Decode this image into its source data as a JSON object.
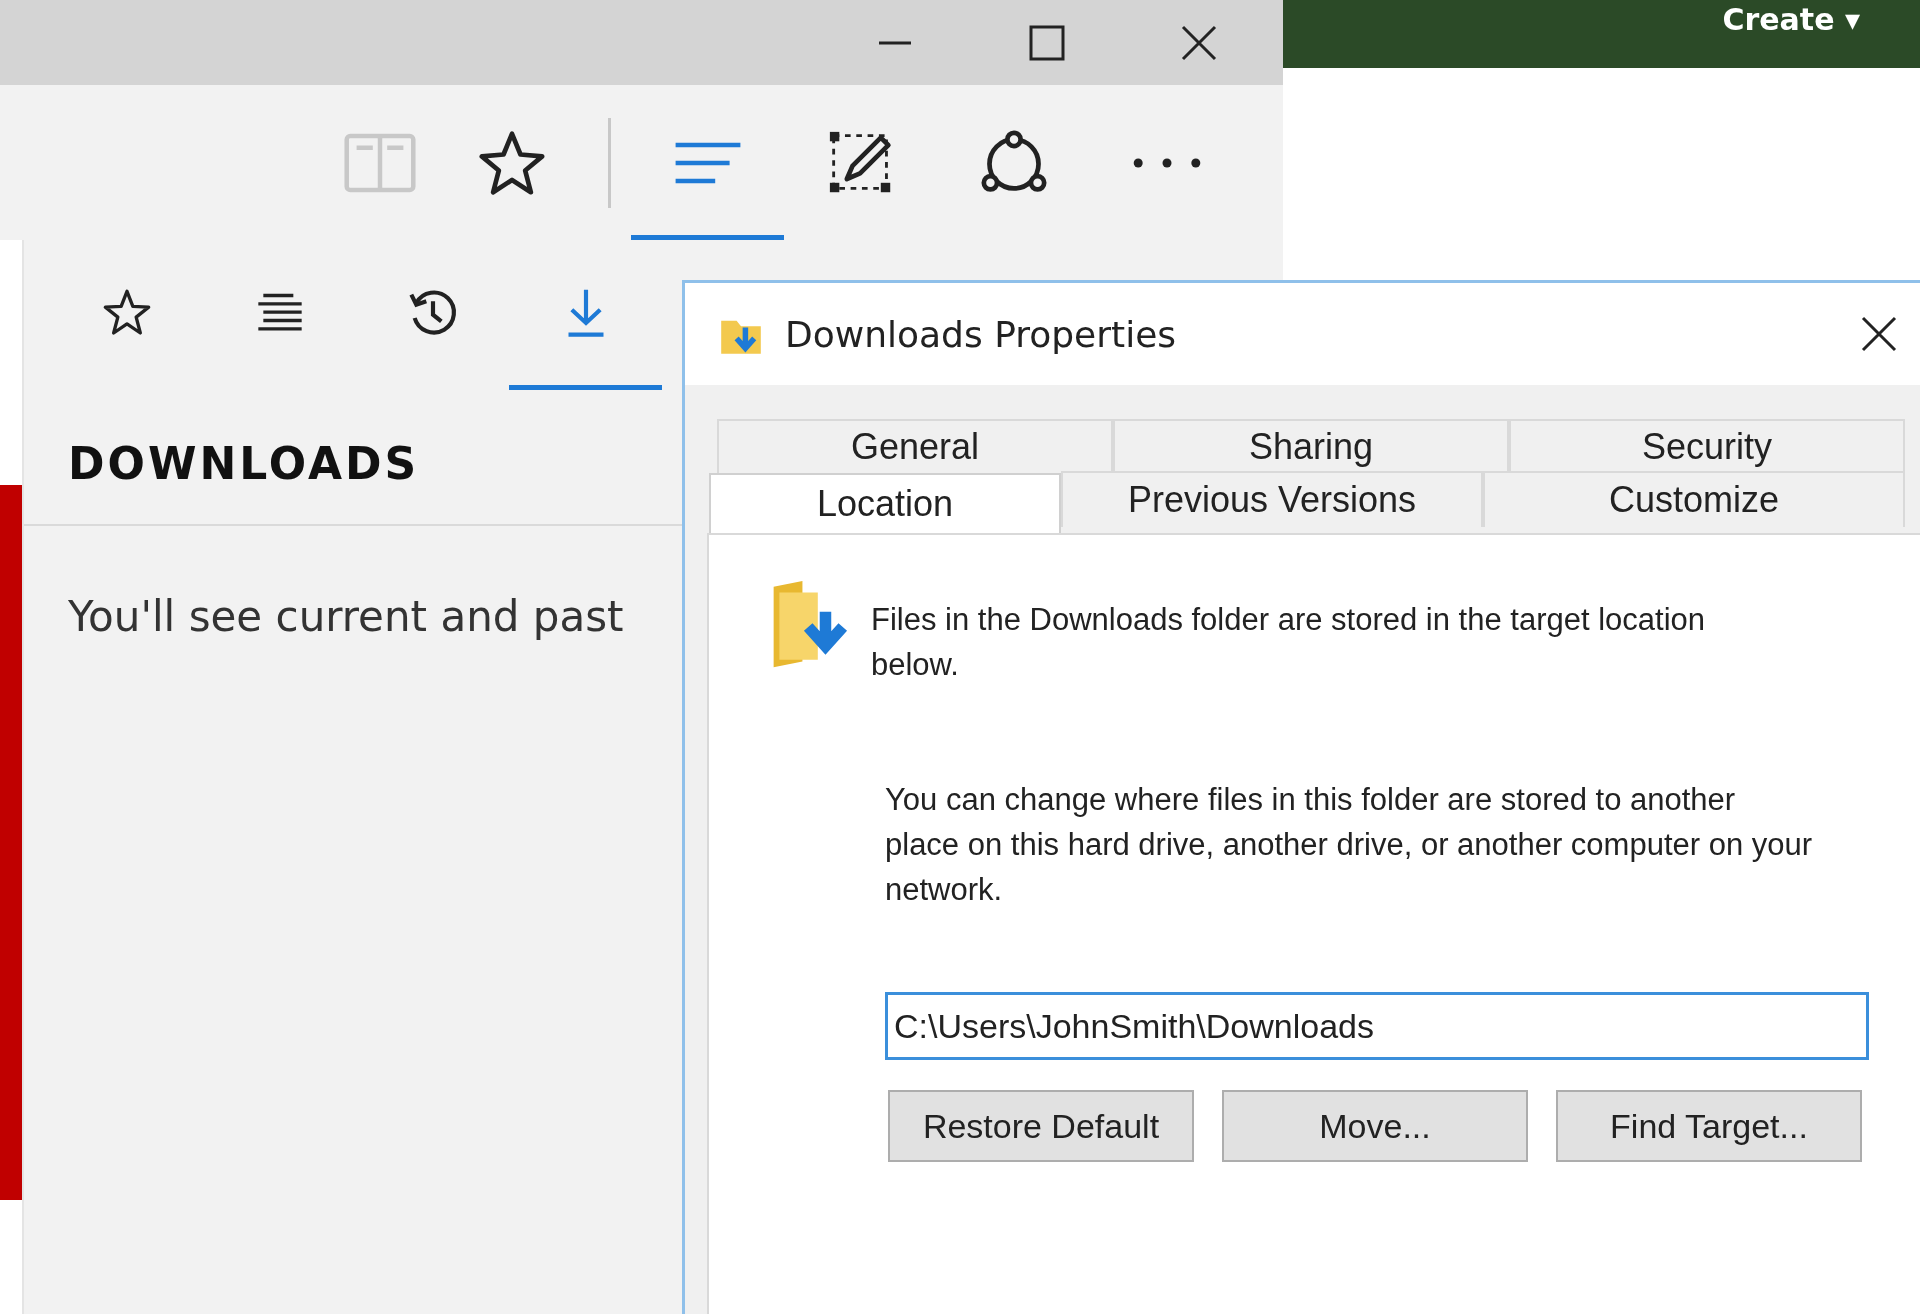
{
  "site_header": {
    "menu_label": "Create ▾"
  },
  "toolbar": {
    "buttons": [
      {
        "kind": "reading-view",
        "selected": false,
        "disabled": true
      },
      {
        "kind": "favorite",
        "selected": false,
        "disabled": false
      },
      {
        "kind": "hub",
        "selected": true,
        "disabled": false
      },
      {
        "kind": "web-note",
        "selected": false,
        "disabled": false
      },
      {
        "kind": "share",
        "selected": false,
        "disabled": false
      },
      {
        "kind": "more",
        "selected": false,
        "disabled": false
      }
    ]
  },
  "hub": {
    "tabs": [
      {
        "kind": "favorites",
        "selected": false
      },
      {
        "kind": "reading-list",
        "selected": false
      },
      {
        "kind": "history",
        "selected": false
      },
      {
        "kind": "downloads",
        "selected": true
      }
    ],
    "heading": "DOWNLOADS",
    "message": "You'll see current and past"
  },
  "dialog": {
    "title": "Downloads Properties",
    "tab_rows": [
      [
        {
          "label": "General",
          "selected": false
        },
        {
          "label": "Sharing",
          "selected": false
        },
        {
          "label": "Security",
          "selected": false
        }
      ],
      [
        {
          "label": "Location",
          "selected": true
        },
        {
          "label": "Previous Versions",
          "selected": false
        },
        {
          "label": "Customize",
          "selected": false
        }
      ]
    ],
    "intro": "Files in the Downloads folder are stored in the target location below.",
    "description": "You can change where files in this folder are stored to another place on this hard drive, another drive, or another computer on your network.",
    "path": {
      "value": "C:\\Users\\JohnSmith\\Downloads"
    },
    "buttons": [
      "Restore Default",
      "Move...",
      "Find Target..."
    ]
  }
}
